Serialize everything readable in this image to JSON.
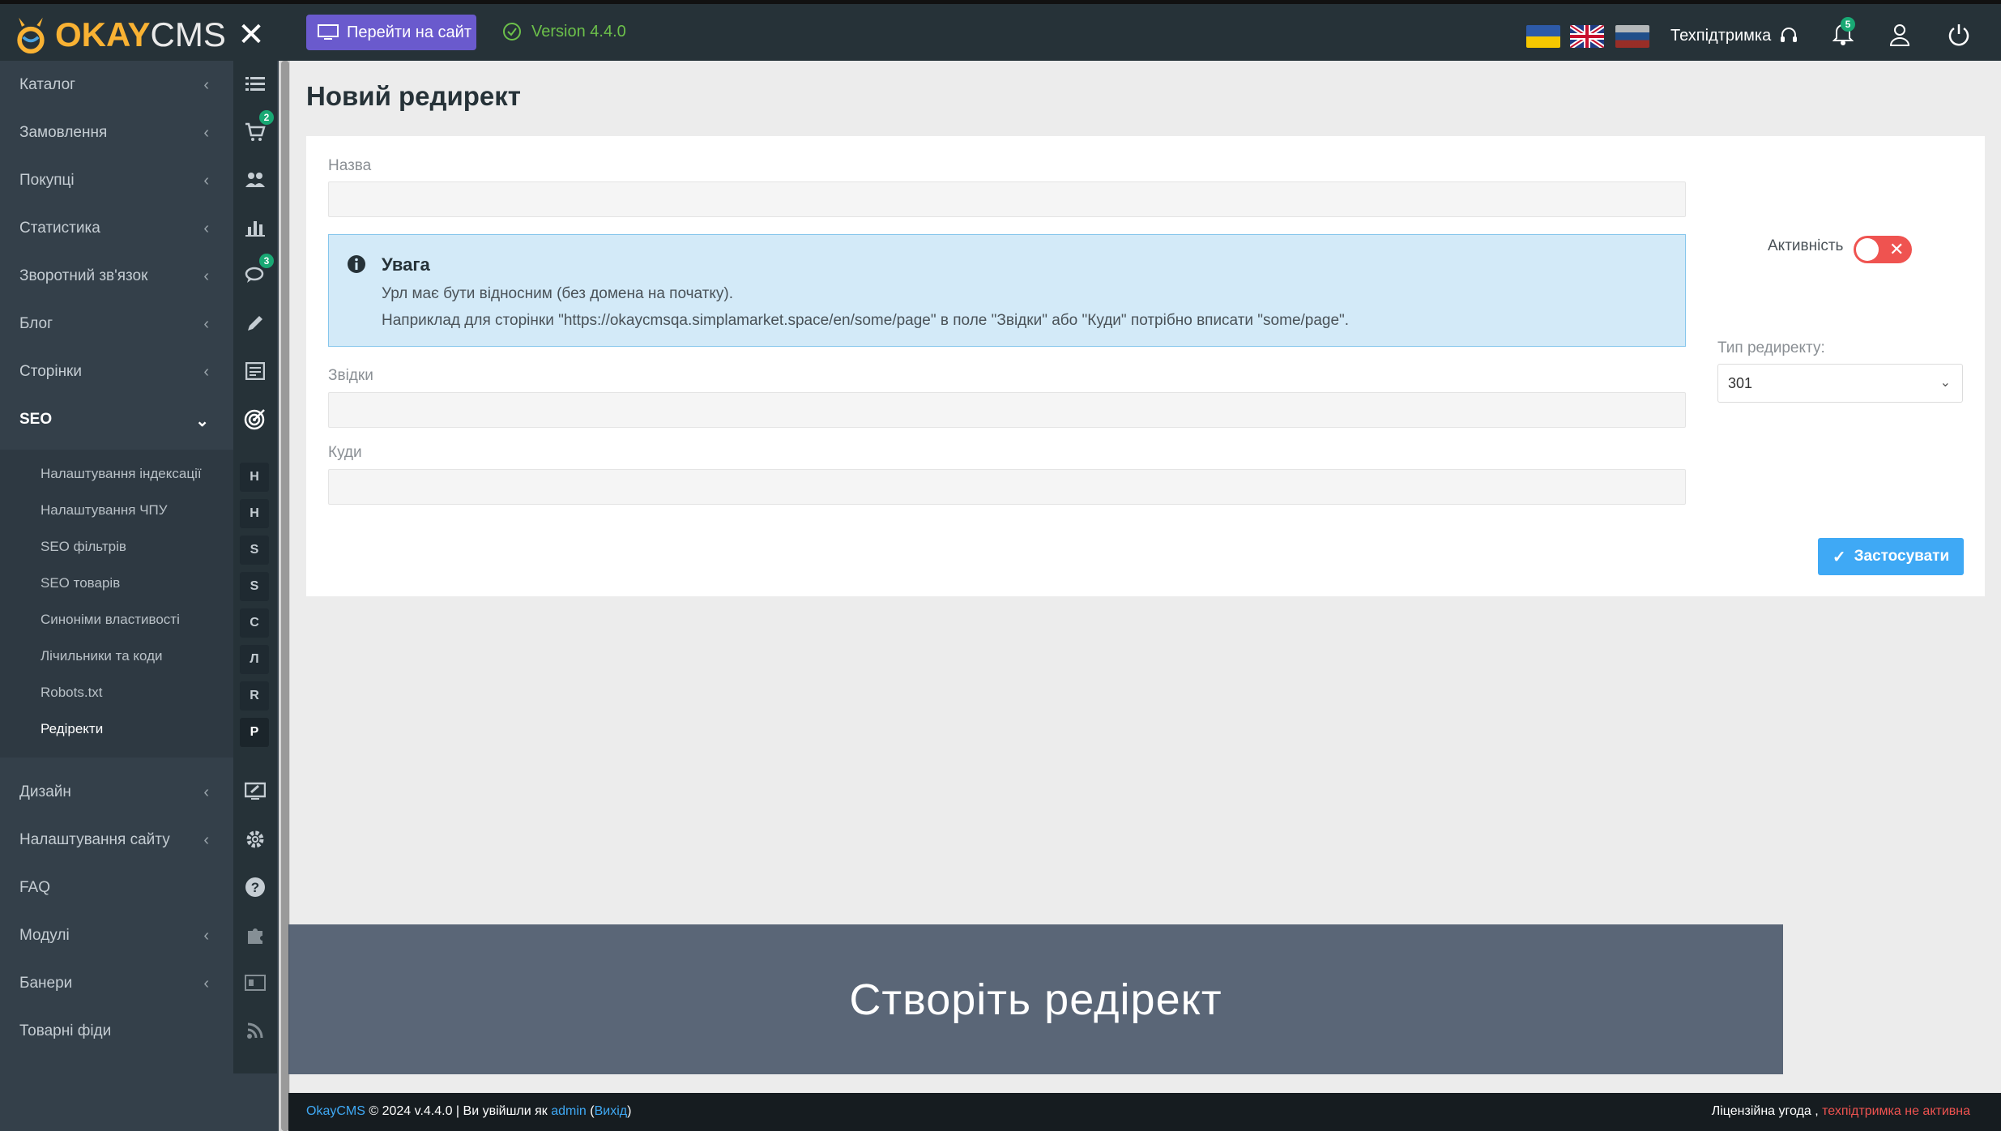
{
  "header": {
    "logo_okay": "OKAY",
    "logo_cms": "CMS",
    "goto_site": "Перейти на сайт",
    "version": "Version 4.4.0",
    "support": "Техпідтримка",
    "notifications_count": "5"
  },
  "sidebar": {
    "items": [
      {
        "label": "Каталог",
        "icon": "list-icon"
      },
      {
        "label": "Замовлення",
        "icon": "cart-icon",
        "badge": "2"
      },
      {
        "label": "Покупці",
        "icon": "users-icon"
      },
      {
        "label": "Статистика",
        "icon": "bar-chart-icon"
      },
      {
        "label": "Зворотний зв'язок",
        "icon": "comments-icon",
        "badge": "3"
      },
      {
        "label": "Блог",
        "icon": "pencil-icon"
      },
      {
        "label": "Сторінки",
        "icon": "pages-icon"
      },
      {
        "label": "SEO",
        "icon": "target-icon"
      }
    ],
    "seo_subitems": [
      {
        "label": "Налаштування індексації",
        "letter": "Н"
      },
      {
        "label": "Налаштування ЧПУ",
        "letter": "Н"
      },
      {
        "label": "SEO фільтрів",
        "letter": "S"
      },
      {
        "label": "SEO товарів",
        "letter": "S"
      },
      {
        "label": "Синоніми властивості",
        "letter": "С"
      },
      {
        "label": "Лічильники та коди",
        "letter": "Л"
      },
      {
        "label": "Robots.txt",
        "letter": "R"
      },
      {
        "label": "Редіректи",
        "letter": "Р"
      }
    ],
    "bottom_items": [
      {
        "label": "Дизайн",
        "icon": "design-icon"
      },
      {
        "label": "Налаштування сайту",
        "icon": "gear-icon"
      },
      {
        "label": "FAQ",
        "icon": "question-icon"
      },
      {
        "label": "Модулі",
        "icon": "puzzle-icon"
      },
      {
        "label": "Банери",
        "icon": "banner-icon"
      },
      {
        "label": "Товарні фіди",
        "icon": "rss-icon"
      }
    ]
  },
  "main": {
    "title": "Новий редирект",
    "name_label": "Назва",
    "name_value": "",
    "alert_title": "Увага",
    "alert_line1": "Урл має бути відносним (без домена на початку).",
    "alert_line2": "Наприклад для сторінки \"https://okaycmsqa.simplamarket.space/en/some/page\" в поле \"Звідки\" або \"Куди\" потрібно вписати \"some/page\".",
    "from_label": "Звідки",
    "from_value": "",
    "to_label": "Куди",
    "to_value": "",
    "active_label": "Активність",
    "active": false,
    "type_label": "Тип редиректу:",
    "type_value": "301",
    "apply_label": "Застосувати"
  },
  "overlay": {
    "caption": "Створіть редірект"
  },
  "footer": {
    "brand": "OkayCMS",
    "copyright": "© 2024 v.4.4.0 | Ви увійшли як",
    "user": "admin",
    "logout": "Вихід",
    "license": "Ліцензійна угода ,",
    "support_status": "техпідтримка не активна"
  },
  "colors": {
    "accent": "#3fa9f5",
    "goto_button": "#6a5acd",
    "toggle_off": "#ef5350",
    "version_green": "#6cc04a"
  }
}
